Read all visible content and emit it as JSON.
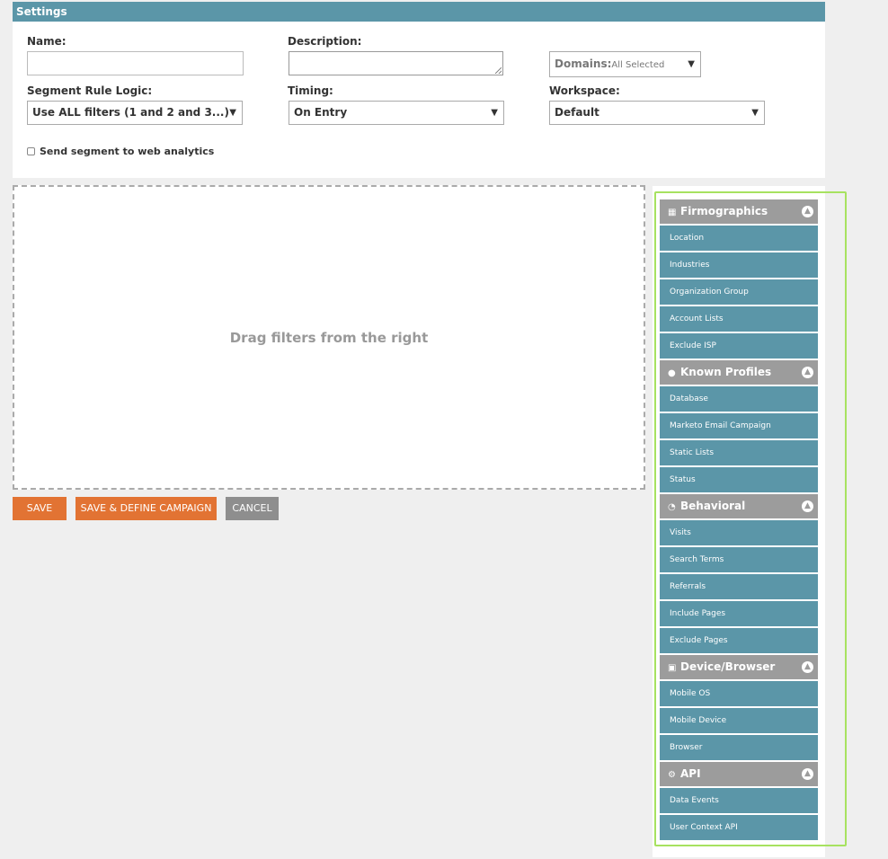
{
  "settings": {
    "title": "Settings",
    "name_label": "Name:",
    "name_value": "",
    "description_label": "Description:",
    "description_value": "",
    "domains_label": "Domains:",
    "domains_value": "All Selected",
    "rule_logic_label": "Segment Rule Logic:",
    "rule_logic_value": "Use ALL filters (1 and 2 and 3...)",
    "timing_label": "Timing:",
    "timing_value": "On Entry",
    "workspace_label": "Workspace:",
    "workspace_value": "Default",
    "web_analytics_label": "Send segment to web analytics",
    "web_analytics_checked": false
  },
  "drop_zone": {
    "text": "Drag filters from the right"
  },
  "actions": {
    "save": "SAVE",
    "save_define": "SAVE & DEFINE CAMPAIGN",
    "cancel": "CANCEL"
  },
  "colors": {
    "header": "#5b96a8",
    "filter_item": "#5b96a8",
    "group_header": "#9c9c9c",
    "primary_button": "#e27333",
    "cancel_button": "#8e8e8e",
    "highlight": "#a7e260"
  },
  "filter_groups": [
    {
      "title": "Firmographics",
      "icon": "building-icon",
      "items": [
        "Location",
        "Industries",
        "Organization Group",
        "Account Lists",
        "Exclude ISP"
      ]
    },
    {
      "title": "Known Profiles",
      "icon": "person-icon",
      "items": [
        "Database",
        "Marketo Email Campaign",
        "Static Lists",
        "Status"
      ]
    },
    {
      "title": "Behavioral",
      "icon": "behavior-icon",
      "items": [
        "Visits",
        "Search Terms",
        "Referrals",
        "Include Pages",
        "Exclude Pages"
      ]
    },
    {
      "title": "Device/Browser",
      "icon": "browser-icon",
      "items": [
        "Mobile OS",
        "Mobile Device",
        "Browser"
      ]
    },
    {
      "title": "API",
      "icon": "gears-icon",
      "items": [
        "Data Events",
        "User Context API"
      ]
    }
  ]
}
